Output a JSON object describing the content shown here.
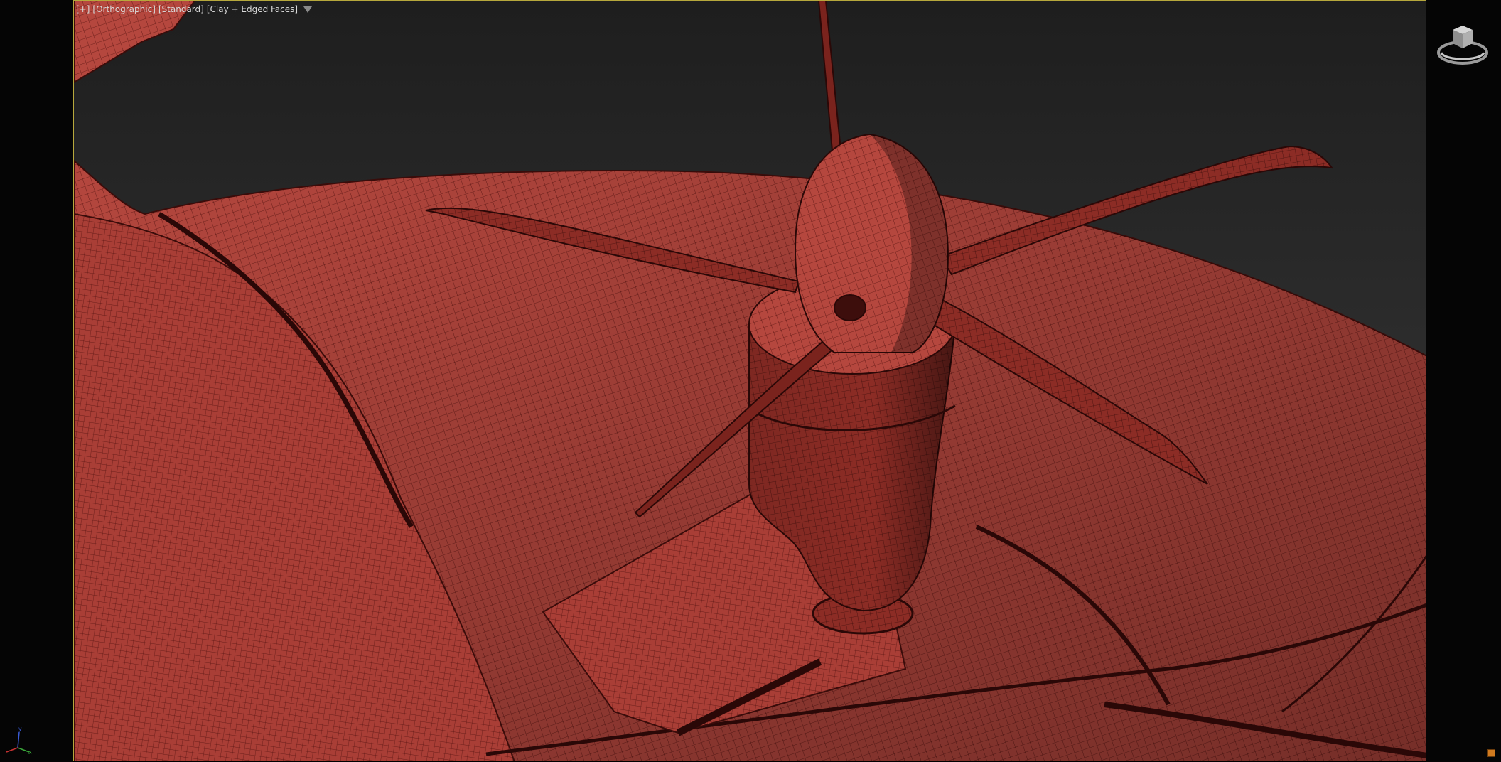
{
  "viewport": {
    "labels": [
      "[+]",
      "[Orthographic]",
      "[Standard]",
      "[Clay + Edged Faces]"
    ],
    "filter_icon": "filter-icon",
    "border_color": "#b7a83c"
  },
  "scene": {
    "mesh_color": "#b5473e",
    "wire_color": "#5a1512",
    "background_top": "#1e1e1e",
    "background_bottom": "#323232"
  },
  "icons": {
    "viewcube": "viewcube-icon",
    "axis": "axis-tripod-icon",
    "corner": "viewport-corner-icon"
  },
  "axis_labels": {
    "y": "y",
    "x": "x"
  }
}
